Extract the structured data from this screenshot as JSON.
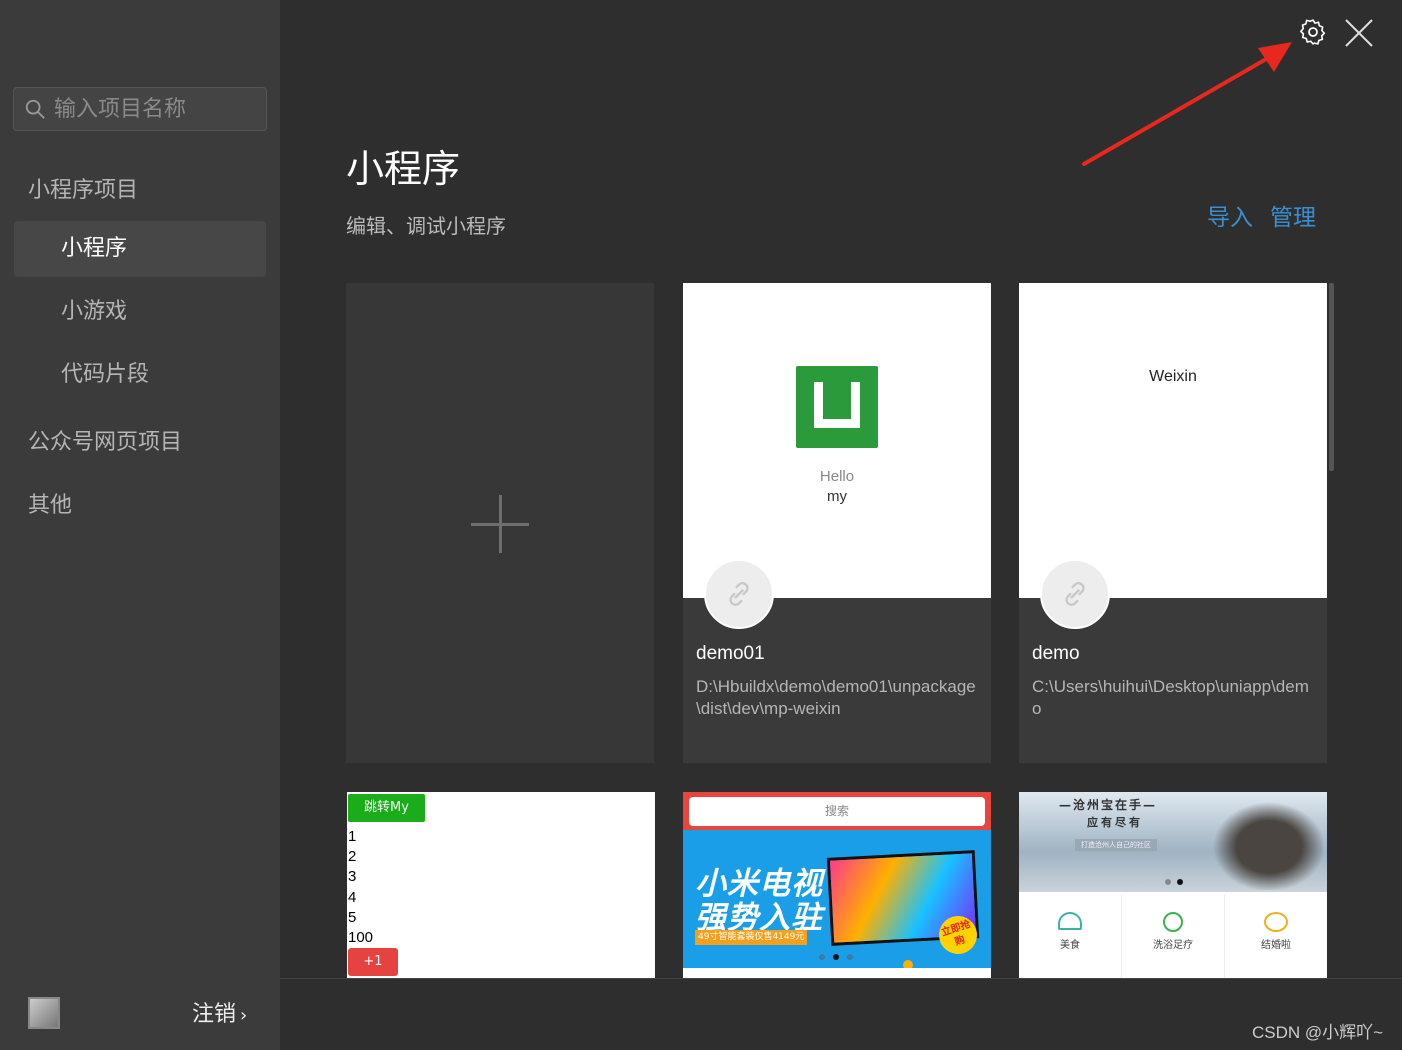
{
  "search": {
    "placeholder": "输入项目名称",
    "value": ""
  },
  "sidebar": {
    "group_miniprogram": "小程序项目",
    "items": [
      "小程序",
      "小游戏",
      "代码片段"
    ],
    "group_web": "公众号网页项目",
    "group_other": "其他",
    "active": "小程序"
  },
  "header": {
    "title": "小程序",
    "subtitle": "编辑、调试小程序",
    "import_label": "导入",
    "manage_label": "管理"
  },
  "projects": [
    {
      "name": "demo01",
      "path": "D:\\Hbuildx\\demo\\demo01\\unpackage\\dist\\dev\\mp-weixin",
      "preview_line1": "Hello",
      "preview_line2": "my"
    },
    {
      "name": "demo",
      "path": "C:\\Users\\huihui\\Desktop\\uniapp\\demo",
      "preview_text": "Weixin"
    }
  ],
  "thumbs": {
    "t1": {
      "button": "跳转My",
      "lines": [
        "1",
        "2",
        "3",
        "4",
        "5",
        "100"
      ],
      "plus": "+1"
    },
    "t2": {
      "search": "搜索",
      "banner_line1": "小米电视",
      "banner_line2": "强势入驻",
      "tag": "49寸智能套装仅售4149元",
      "badge": "立即抢购"
    },
    "t3": {
      "headline": "—沧州宝在手—",
      "sub": "应有尽有",
      "hint": "打造沧州人自己的社区",
      "cats": [
        "美食",
        "洗浴足疗",
        "结婚啦"
      ]
    }
  },
  "footer": {
    "logout_label": "注销"
  },
  "watermark": "CSDN @小辉吖~",
  "colors": {
    "accent_link": "#3b8fd0",
    "sidebar_bg": "#3b3b3b",
    "main_bg": "#2e2e2e",
    "arrow": "#e8281e"
  },
  "icons": [
    "search-icon",
    "gear-icon",
    "close-icon",
    "link-icon",
    "chevron-right-icon"
  ]
}
